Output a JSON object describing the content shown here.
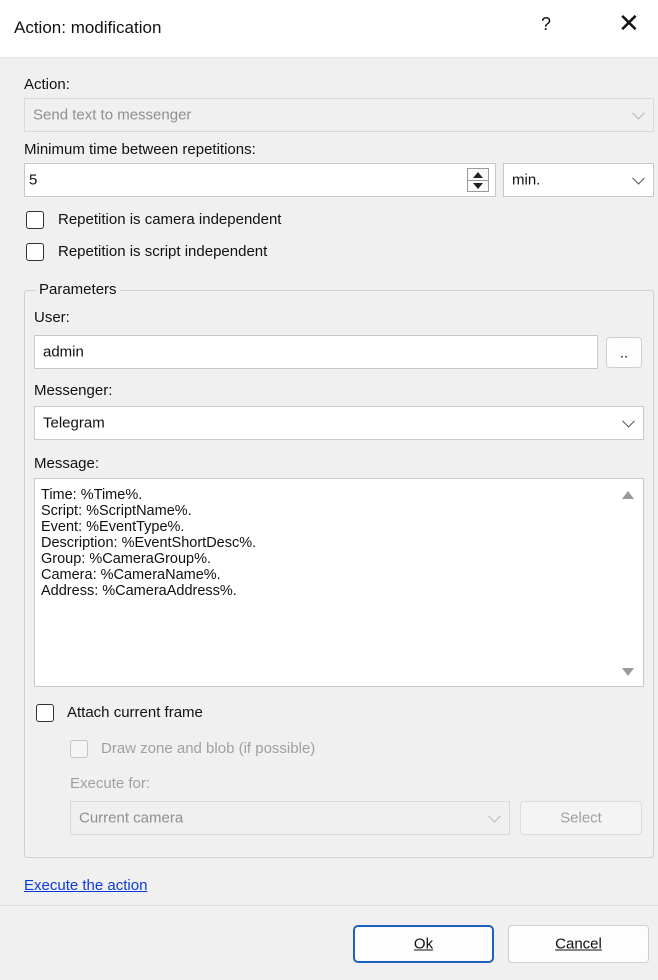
{
  "window": {
    "title": "Action: modification",
    "help_label": "?",
    "close_label": "✕"
  },
  "action": {
    "label": "Action:",
    "value": "Send text to messenger"
  },
  "min_time": {
    "label": "Minimum time between repetitions:",
    "value": "5",
    "unit": "min."
  },
  "checks": {
    "camera_independent": "Repetition is camera independent",
    "script_independent": "Repetition is script independent"
  },
  "parameters": {
    "legend": "Parameters",
    "user_label": "User:",
    "user_value": "admin",
    "browse_label": "..",
    "messenger_label": "Messenger:",
    "messenger_value": "Telegram",
    "message_label": "Message:",
    "message_lines": [
      "Time: %Time%.",
      "Script: %ScriptName%.",
      "Event: %EventType%.",
      "Description: %EventShortDesc%.",
      "Group: %CameraGroup%.",
      "Camera: %CameraName%.",
      "Address: %CameraAddress%."
    ],
    "attach_label": "Attach current frame",
    "draw_zone_label": "Draw zone and blob (if possible)",
    "execute_for_label": "Execute for:",
    "execute_for_value": "Current camera",
    "select_label": "Select"
  },
  "execute_link": "Execute the action",
  "buttons": {
    "ok": "Ok",
    "cancel": "Cancel"
  }
}
